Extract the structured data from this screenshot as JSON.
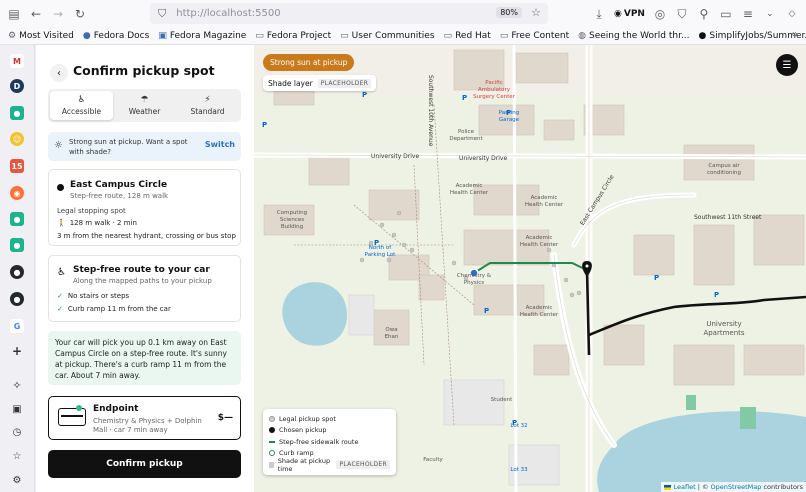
{
  "browser": {
    "url": "http://localhost:5500",
    "zoom": "80%",
    "vpn_label": "VPN"
  },
  "bookmarks": [
    {
      "label": "Most Visited",
      "icon": "gear-icon"
    },
    {
      "label": "Fedora Docs",
      "icon": "fedora-icon"
    },
    {
      "label": "Fedora Magazine",
      "icon": "magazine-icon"
    },
    {
      "label": "Fedora Project",
      "icon": "folder-icon"
    },
    {
      "label": "User Communities",
      "icon": "folder-icon"
    },
    {
      "label": "Red Hat",
      "icon": "folder-icon"
    },
    {
      "label": "Free Content",
      "icon": "folder-icon"
    },
    {
      "label": "Seeing the World thr...",
      "icon": "globe-icon"
    },
    {
      "label": "SimplifyJobs/Summer...",
      "icon": "github-icon"
    }
  ],
  "panel": {
    "title": "Confirm pickup spot",
    "tabs": [
      {
        "label": "Accessible",
        "icon": "accessibility-icon",
        "active": true
      },
      {
        "label": "Weather",
        "icon": "umbrella-icon",
        "active": false
      },
      {
        "label": "Standard",
        "icon": "lightning-icon",
        "active": false
      }
    ],
    "alert": {
      "text": "Strong sun at pickup. Want a spot with shade?",
      "action": "Switch"
    },
    "spot": {
      "title": "East Campus Circle",
      "subtitle": "Step-free route, 128 m walk",
      "kind": "Legal stopping spot",
      "walk": "128 m walk · 2 min",
      "distance_note": "3 m from the nearest hydrant, crossing or bus stop"
    },
    "route": {
      "title": "Step-free route to your car",
      "subtitle": "Along the mapped paths to your pickup",
      "checks": [
        "No stairs or steps",
        "Curb ramp 11 m from the car"
      ]
    },
    "summary": "Your car will pick you up 0.1 km away on East Campus Circle on a step-free route. It's sunny at pickup. There's a curb ramp 11 m from the car. About 7 min away.",
    "endpoint": {
      "title": "Endpoint",
      "subtitle": "Chemistry & Physics + Dolphin Mall · car 7 min away",
      "price": "$—"
    },
    "confirm_label": "Confirm pickup"
  },
  "map": {
    "sun_pill": "Strong sun at pickup",
    "shade_layer": "Shade layer",
    "placeholder": "PLACEHOLDER",
    "legend": [
      {
        "label": "Legal pickup spot",
        "swatch": "#cfcfcf",
        "kind": "dot"
      },
      {
        "label": "Chosen pickup",
        "swatch": "#111111",
        "kind": "dot"
      },
      {
        "label": "Step-free sidewalk route",
        "swatch": "#1f8a4c",
        "kind": "line"
      },
      {
        "label": "Curb ramp",
        "swatch": "#2e8f4f",
        "kind": "ring"
      },
      {
        "label": "Shade at pickup time",
        "swatch": "#c9c9d6",
        "kind": "square",
        "tag": "PLACEHOLDER"
      }
    ],
    "labels": {
      "hospital": "Pacific Ambulatory Surgery Center",
      "parking_garage": "Parking Garage",
      "police": "Police Department",
      "university_drive": "University Drive",
      "southwest_11th": "Southwest 11th Street",
      "east_campus_circle": "East Campus Circle",
      "avenue": "Southwest 10th Avenue",
      "academic_health": "Academic Health Center",
      "campus_ac": "Campus air conditioning",
      "computing": "Computing Sciences Building",
      "north_lot": "North of Parking Lot",
      "chem_phys": "Chemistry & Physics",
      "owa_ehan": "Owa Ehan",
      "univ_apts": "University Apartments",
      "lot_32": "Lot 32",
      "lot_33": "Lot 33",
      "faculty": "Faculty",
      "student": "Student"
    },
    "attribution_leaflet": "Leaflet",
    "attribution_osm": "OpenStreetMap",
    "attribution_suffix": "contributors"
  }
}
